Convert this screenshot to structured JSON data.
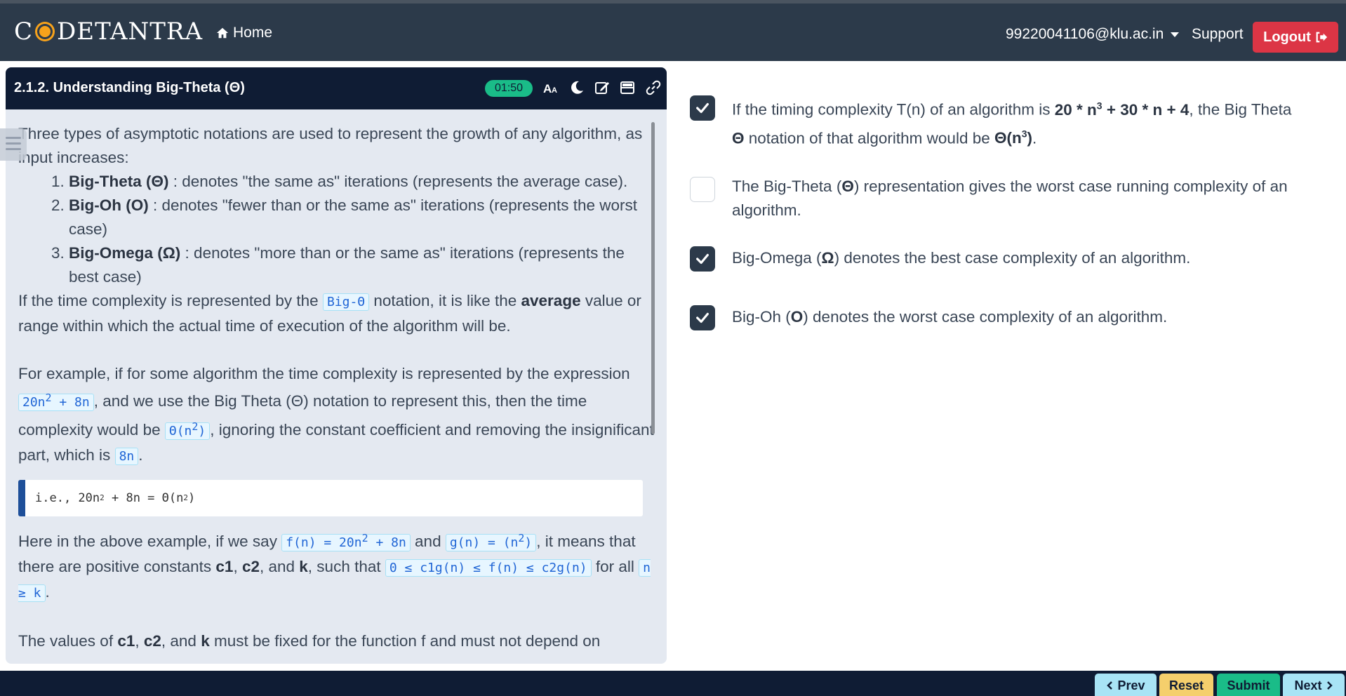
{
  "navbar": {
    "brand_part1": "C",
    "brand_part2": "DETANTRA",
    "home_label": "Home",
    "user_email": "99220041106@klu.ac.in",
    "support_label": "Support",
    "logout_label": "Logout"
  },
  "lesson": {
    "title": "2.1.2. Understanding Big-Theta (Θ)",
    "timer": "01:50",
    "intro": "Three types of asymptotic notations are used to represent the growth of any algorithm, as input increases:",
    "notations": [
      {
        "name": "Big-Theta (Θ)",
        "desc": " : denotes \"the same as\" iterations (represents the average case)."
      },
      {
        "name": "Big-Oh (O)",
        "desc": " : denotes \"fewer than or the same as\" iterations (represents the worst case)"
      },
      {
        "name": "Big-Omega (Ω)",
        "desc": " : denotes \"more than or the same as\" iterations (represents the best case)"
      }
    ],
    "p2_a": "If the time complexity is represented by the ",
    "p2_code": "Big-Θ",
    "p2_b": " notation, it is like the ",
    "p2_bold": "average",
    "p2_c": " value or range within which the actual time of execution of the algorithm will be.",
    "p3_a": "For example, if for some algorithm the time complexity is represented by the expression ",
    "p3_code1_a": "20n",
    "p3_code1_b": " + 8n",
    "p3_b": ", and we use the Big Theta (Θ) notation to represent this, then the time complexity would be ",
    "p3_code2_a": "Θ(n",
    "p3_code2_b": ")",
    "p3_c": ", ignoring the constant coefficient and removing the insignificant part, which is ",
    "p3_code3": "8n",
    "p3_d": ".",
    "codeblock_a": "i.e., 20n",
    "codeblock_b": " + 8n = Θ(n",
    "codeblock_c": ")",
    "sup2": "2",
    "p4_a": "Here in the above example, if we say ",
    "p4_code1_a": "f(n) = 20n",
    "p4_code1_b": " + 8n",
    "p4_b": " and ",
    "p4_code2_a": "g(n) = (n",
    "p4_code2_b": ")",
    "p4_c": ", it means that there are positive constants ",
    "p4_c1": "c1",
    "p4_comma1": ", ",
    "p4_c2": "c2",
    "p4_and": ", and ",
    "p4_k": "k",
    "p4_d": ", such that ",
    "p4_code3": "0 ≤ c1g(n) ≤ f(n) ≤ c2g(n)",
    "p4_e": " for all ",
    "p4_code4": "n ≥ k",
    "p4_f": ".",
    "p5_a": "The values of ",
    "p5_c1": "c1",
    "p5_comma": ", ",
    "p5_c2": "c2",
    "p5_and": ", and ",
    "p5_k": "k",
    "p5_b": " must be fixed for the function f and must not depend on"
  },
  "options": [
    {
      "checked": true,
      "t1": "If the timing complexity T(n) of an algorithm is ",
      "b1": "20 * n",
      "sup1": "3",
      "b1b": " + 30 * n + 4",
      "t2": ", the Big Theta ",
      "b2": "Θ",
      "t3": " notation of that algorithm would be ",
      "b3": "Θ(n",
      "sup2": "3",
      "b3b": ")",
      "t4": "."
    },
    {
      "checked": false,
      "t1": "The Big-Theta (",
      "b1": "Θ",
      "t2": ") representation gives the worst case running complexity of an algorithm."
    },
    {
      "checked": true,
      "t1": "Big-Omega (",
      "b1": "Ω",
      "t2": ") denotes the best case complexity of an algorithm."
    },
    {
      "checked": true,
      "t1": "Big-Oh (",
      "b1": "O",
      "t2": ") denotes the worst case complexity of an algorithm."
    }
  ],
  "footer": {
    "prev_label": "Prev",
    "reset_label": "Reset",
    "submit_label": "Submit",
    "next_label": "Next"
  },
  "colors": {
    "navbar": "#2c3a4a",
    "header": "#0f1c34",
    "logout": "#dc3545",
    "timer": "#1abc88",
    "prev": "#a8e4f5",
    "reset": "#f5cf6c",
    "submit": "#1abc88",
    "next": "#a8e4f5"
  },
  "icons": [
    "home-icon",
    "caret-down-icon",
    "logout-icon",
    "font-size-icon",
    "moon-icon",
    "edit-icon",
    "layout-icon",
    "link-icon",
    "list-icon",
    "check-icon",
    "chevron-left-icon",
    "chevron-right-icon"
  ]
}
